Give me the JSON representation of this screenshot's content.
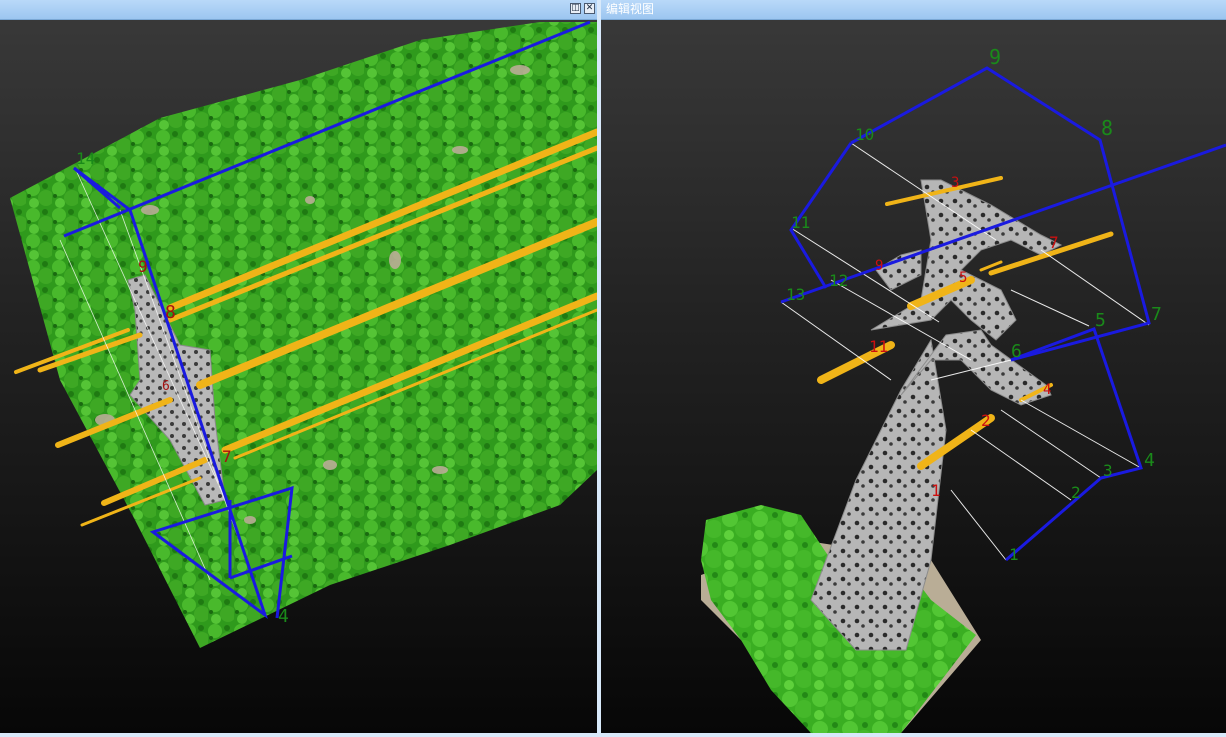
{
  "left_view": {
    "title": "",
    "buttons": {
      "restore_icon": "restore-icon",
      "close_icon": "close-icon"
    },
    "point_labels": {
      "p14": "14",
      "p9": "9",
      "p8": "8",
      "p6": "6",
      "p7": "7",
      "p4": "4"
    }
  },
  "right_view": {
    "title": "编辑视图",
    "point_labels": {
      "p9": "9",
      "p8": "8",
      "p10": "10",
      "p11": "11",
      "p12": "12",
      "p13": "13",
      "p7": "7",
      "p5": "5",
      "p6": "6",
      "p4": "4",
      "p3": "3",
      "p2": "2",
      "p1": "1"
    },
    "insulator_labels": {
      "i3": "3",
      "i7": "7",
      "i9": "9",
      "i5": "5",
      "i11": "11",
      "i4": "4",
      "i2": "2",
      "i1": "1"
    }
  },
  "colors": {
    "vegetation": "#3fae22",
    "vegetation_dark": "#1f7a12",
    "tower": "#b4b4b4",
    "conductor": "#f0b418",
    "boundary_line": "#1a1ae0",
    "point_label": "#1a8a1a",
    "insulator_label": "#cc1010",
    "ground": "#b9ad96"
  }
}
